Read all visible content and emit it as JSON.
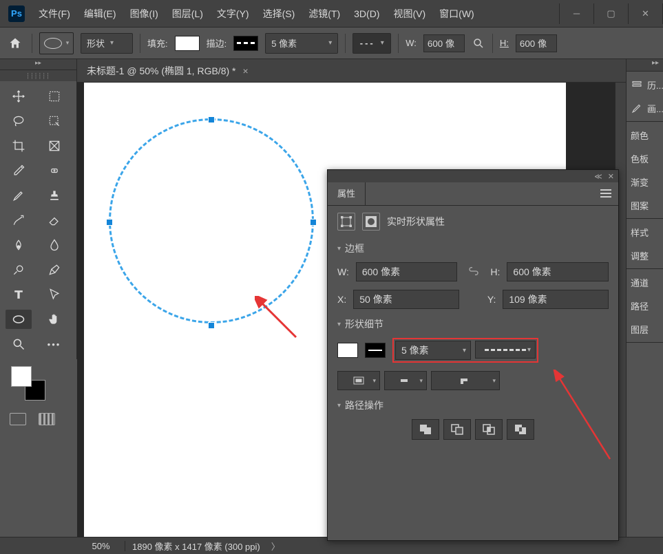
{
  "menu": {
    "file": "文件(F)",
    "edit": "编辑(E)",
    "image": "图像(I)",
    "layer": "图层(L)",
    "type": "文字(Y)",
    "select": "选择(S)",
    "filter": "滤镜(T)",
    "threed": "3D(D)",
    "view": "视图(V)",
    "window": "窗口(W)"
  },
  "options": {
    "shape_label": "形状",
    "fill_label": "填充:",
    "stroke_label": "描边:",
    "stroke_width": "5 像素",
    "w_label": "W:",
    "w_value": "600 像",
    "h_label": "H:",
    "h_value": "600 像"
  },
  "document": {
    "tab_title": "未标题-1 @ 50% (椭圆 1, RGB/8) *"
  },
  "right_panels": {
    "history": "历...",
    "brush": "画...",
    "color": "颜色",
    "swatches": "色板",
    "gradient": "渐变",
    "pattern": "图案",
    "style": "样式",
    "adjust": "调整",
    "channel": "通道",
    "path": "路径",
    "layer": "图层"
  },
  "properties": {
    "panel_title": "属性",
    "header": "实时形状属性",
    "border_label": "边框",
    "w_label": "W:",
    "w_value": "600 像素",
    "h_label": "H:",
    "h_value": "600 像素",
    "x_label": "X:",
    "x_value": "50 像素",
    "y_label": "Y:",
    "y_value": "109 像素",
    "detail_label": "形状细节",
    "stroke_width": "5 像素",
    "pathops_label": "路径操作"
  },
  "status": {
    "zoom": "50%",
    "info": "1890 像素 x 1417 像素 (300 ppi)"
  }
}
